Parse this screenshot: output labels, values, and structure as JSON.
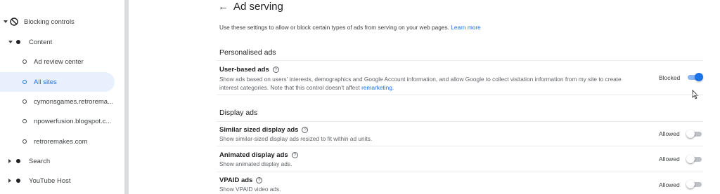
{
  "sidebar": {
    "items": [
      {
        "label": "Blocking controls"
      },
      {
        "label": "Content"
      },
      {
        "label": "Ad review center"
      },
      {
        "label": "All sites"
      },
      {
        "label": "cymonsgames.retrorema..."
      },
      {
        "label": "npowerfusion.blogspot.c..."
      },
      {
        "label": "retroremakes.com"
      },
      {
        "label": "Search"
      },
      {
        "label": "YouTube Host"
      }
    ]
  },
  "header": {
    "back_icon": "←",
    "title": "Ad serving",
    "intro": "Use these settings to allow or block certain types of ads from serving on your web pages.",
    "learn_more": "Learn more"
  },
  "sections": [
    {
      "title": "Personalised ads",
      "rows": [
        {
          "title": "User-based ads",
          "desc": "Show ads based on users' interests, demographics and Google Account information, and allow Google to collect visitation information from my site to create interest categories. Note that this control doesn't affect",
          "desc_link": "remarketing",
          "desc_end": ".",
          "status": "Blocked",
          "on": true
        }
      ]
    },
    {
      "title": "Display ads",
      "rows": [
        {
          "title": "Similar sized display ads",
          "desc": "Show similar-sized display ads resized to fit within ad units.",
          "status": "Allowed",
          "on": false
        },
        {
          "title": "Animated display ads",
          "desc": "Show animated display ads.",
          "status": "Allowed",
          "on": false
        },
        {
          "title": "VPAID ads",
          "desc": "Show VPAID video ads.",
          "status": "Allowed",
          "on": false
        }
      ]
    }
  ],
  "help_icon": "?",
  "colors": {
    "accent": "#1a73e8",
    "selected_bg": "#e8f0fe",
    "toggle_off": "#bdc1c6"
  }
}
